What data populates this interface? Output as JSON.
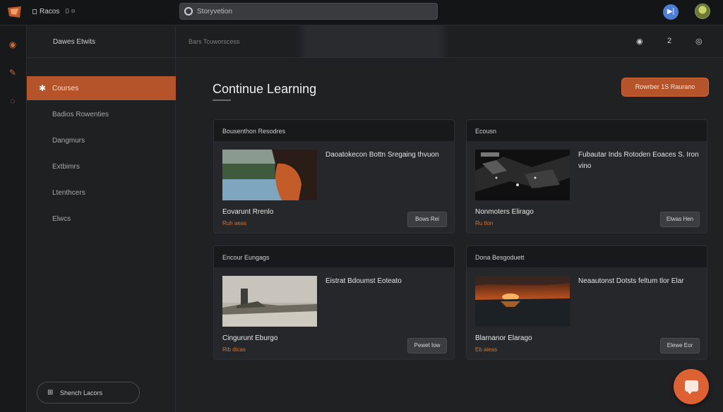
{
  "topbar": {
    "app_title": "Racos",
    "app_extra": "0  ¤",
    "search_placeholder": "Storyvetion",
    "blue_button": "▶|"
  },
  "sidebar": {
    "header": "Dawes Etwits",
    "items": [
      {
        "label": "Courses",
        "active": true
      },
      {
        "label": "Badios Rowenties",
        "active": false
      },
      {
        "label": "Dangmurs",
        "active": false
      },
      {
        "label": "Extbimrs",
        "active": false
      },
      {
        "label": "Ltenthcers",
        "active": false
      },
      {
        "label": "Elwcs",
        "active": false
      }
    ],
    "footer_button": "Shench Lacors"
  },
  "main": {
    "breadcrumb": "Bars Tcuworscess",
    "header_icons": [
      "◉",
      "2",
      "◎"
    ],
    "title": "Continue Learning",
    "cta": "Rowrber 1S   Raurano"
  },
  "cards": [
    {
      "header": "Bousenthon Resodres",
      "desc": "Daoatokecon Bottn Sregaing thvuon",
      "name": "Eovarunt Rrenlo",
      "meta": "Ruh aeas",
      "button": "Bows Rei",
      "thumb": "lake"
    },
    {
      "header": "Ecousn",
      "desc": "Fubautar Inds Rotoden Eoaces S. Iron vino",
      "name": "Nonmoters Elirago",
      "meta": "Ru tlon",
      "button": "Elwas Hen",
      "thumb": "dark"
    },
    {
      "header": "Encour Eungags",
      "desc": "Eistrat Bdoumst Eoteato",
      "name": "Cingurunt Eburgo",
      "meta": "Rib dicas",
      "button": "Pewet Iow",
      "thumb": "castle"
    },
    {
      "header": "Dona Besgoduett",
      "desc": "Neaautonst Dotsts feltum tlor Elar",
      "name": "Blarnanor Elarago",
      "meta": "Eb aieas",
      "button": "Elewe Eor",
      "thumb": "sunset"
    }
  ],
  "colors": {
    "accent": "#b5532a",
    "fab": "#dd6133",
    "meta": "#c9783f"
  }
}
